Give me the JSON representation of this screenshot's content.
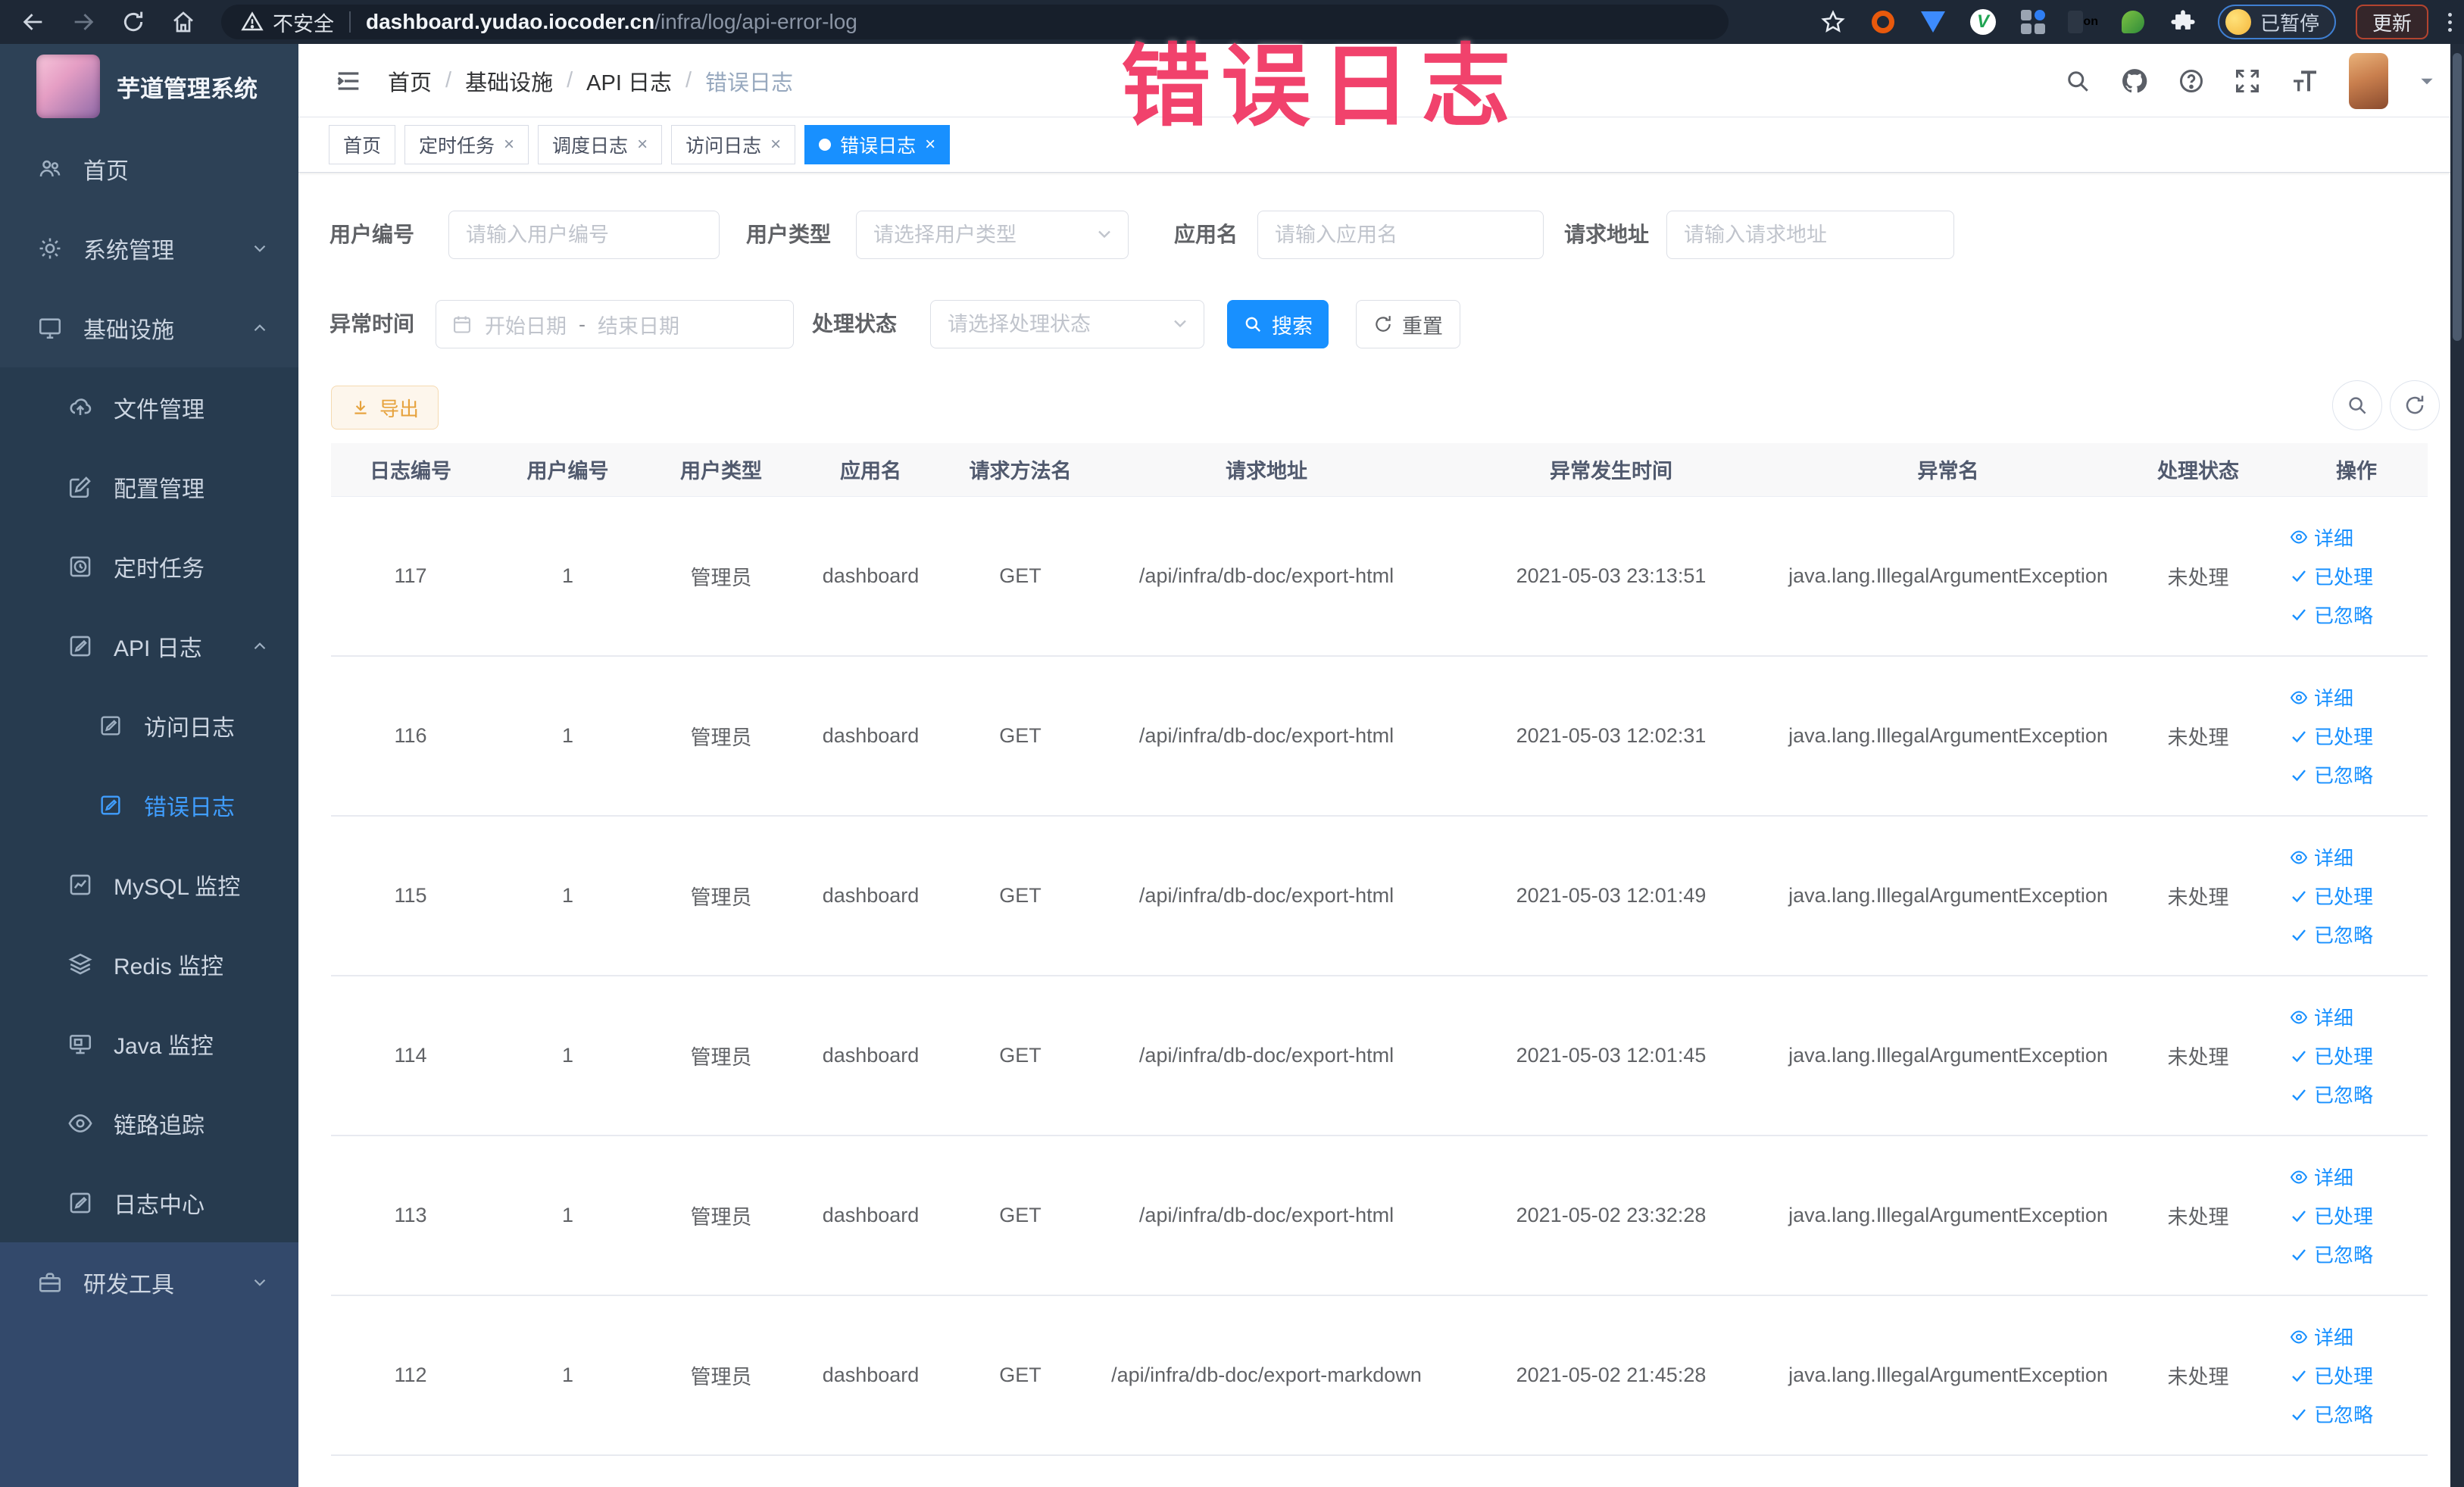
{
  "browser": {
    "security_label": "不安全",
    "url_domain": "dashboard.yudao.iocoder.cn",
    "url_path": "/infra/log/api-error-log",
    "ext_on_badge": "on",
    "paused_badge": "已暂停",
    "update_label": "更新"
  },
  "overlay": {
    "title": "错误日志"
  },
  "sidebar": {
    "logo_title": "芋道管理系统",
    "home": "首页",
    "system": "系统管理",
    "infra": "基础设施",
    "dev_tools": "研发工具",
    "infra_children": {
      "file": "文件管理",
      "config": "配置管理",
      "job": "定时任务",
      "api_log": "API 日志",
      "access_log": "访问日志",
      "error_log": "错误日志",
      "mysql": "MySQL 监控",
      "redis": "Redis 监控",
      "java": "Java 监控",
      "trace": "链路追踪",
      "log_center": "日志中心"
    }
  },
  "navbar": {
    "breadcrumb": [
      "首页",
      "基础设施",
      "API 日志",
      "错误日志"
    ],
    "separator": "/"
  },
  "tabs": {
    "home": "首页",
    "job": "定时任务",
    "job_log": "调度日志",
    "access_log": "访问日志",
    "error_log": "错误日志"
  },
  "filters": {
    "user_id_label": "用户编号",
    "user_id_placeholder": "请输入用户编号",
    "user_type_label": "用户类型",
    "user_type_placeholder": "请选择用户类型",
    "app_name_label": "应用名",
    "app_name_placeholder": "请输入应用名",
    "request_url_label": "请求地址",
    "request_url_placeholder": "请输入请求地址",
    "exception_time_label": "异常时间",
    "date_start_placeholder": "开始日期",
    "date_separator": "-",
    "date_end_placeholder": "结束日期",
    "process_status_label": "处理状态",
    "process_status_placeholder": "请选择处理状态",
    "search_label": "搜索",
    "reset_label": "重置"
  },
  "toolbar": {
    "export_label": "导出"
  },
  "table": {
    "columns": [
      "日志编号",
      "用户编号",
      "用户类型",
      "应用名",
      "请求方法名",
      "请求地址",
      "异常发生时间",
      "异常名",
      "处理状态",
      "操作"
    ],
    "action_labels": {
      "detail": "详细",
      "processed": "已处理",
      "ignored": "已忽略"
    },
    "rows": [
      {
        "log_id": "117",
        "user_id": "1",
        "user_type": "管理员",
        "app_name": "dashboard",
        "method": "GET",
        "url": "/api/infra/db-doc/export-html",
        "time": "2021-05-03 23:13:51",
        "exception": "java.lang.IllegalArgumentException",
        "status": "未处理"
      },
      {
        "log_id": "116",
        "user_id": "1",
        "user_type": "管理员",
        "app_name": "dashboard",
        "method": "GET",
        "url": "/api/infra/db-doc/export-html",
        "time": "2021-05-03 12:02:31",
        "exception": "java.lang.IllegalArgumentException",
        "status": "未处理"
      },
      {
        "log_id": "115",
        "user_id": "1",
        "user_type": "管理员",
        "app_name": "dashboard",
        "method": "GET",
        "url": "/api/infra/db-doc/export-html",
        "time": "2021-05-03 12:01:49",
        "exception": "java.lang.IllegalArgumentException",
        "status": "未处理"
      },
      {
        "log_id": "114",
        "user_id": "1",
        "user_type": "管理员",
        "app_name": "dashboard",
        "method": "GET",
        "url": "/api/infra/db-doc/export-html",
        "time": "2021-05-03 12:01:45",
        "exception": "java.lang.IllegalArgumentException",
        "status": "未处理"
      },
      {
        "log_id": "113",
        "user_id": "1",
        "user_type": "管理员",
        "app_name": "dashboard",
        "method": "GET",
        "url": "/api/infra/db-doc/export-html",
        "time": "2021-05-02 23:32:28",
        "exception": "java.lang.IllegalArgumentException",
        "status": "未处理"
      },
      {
        "log_id": "112",
        "user_id": "1",
        "user_type": "管理员",
        "app_name": "dashboard",
        "method": "GET",
        "url": "/api/infra/db-doc/export-markdown",
        "time": "2021-05-02 21:45:28",
        "exception": "java.lang.IllegalArgumentException",
        "status": "未处理"
      }
    ]
  },
  "colors": {
    "accent": "#1890ff",
    "warning": "#e6a23c",
    "overlay_pink": "#f02d5c",
    "sidebar_bg": "#2d4156"
  }
}
